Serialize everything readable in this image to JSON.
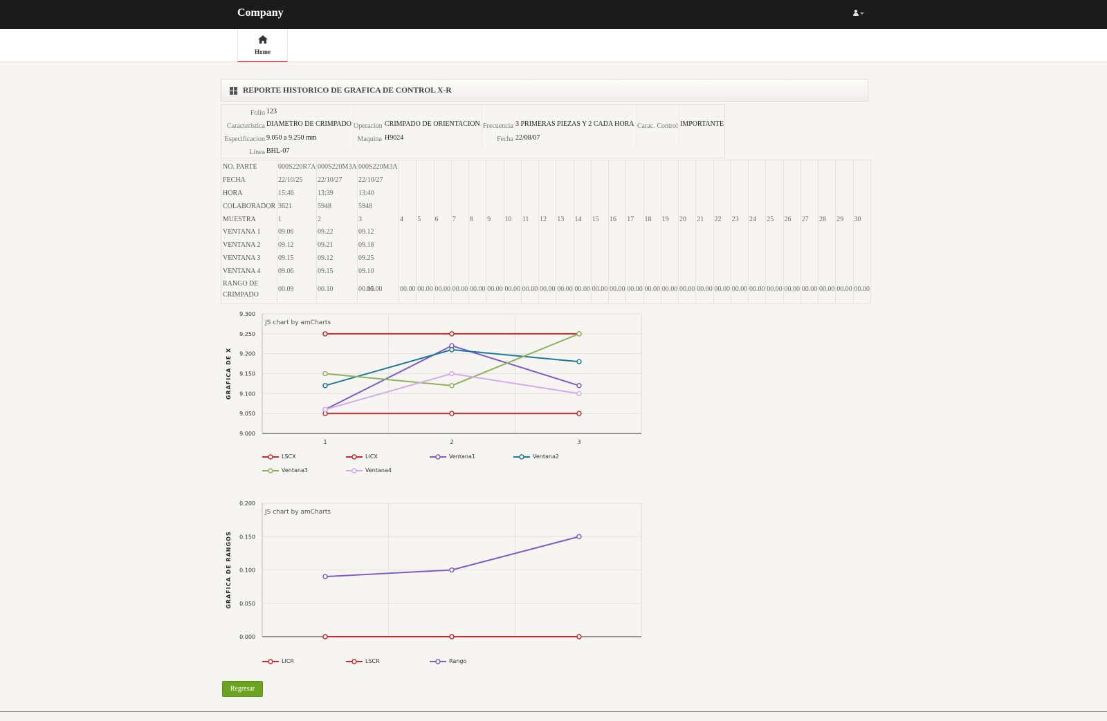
{
  "app": {
    "brand": "Company"
  },
  "nav": {
    "home_label": "Home"
  },
  "panel": {
    "title": "REPORTE HISTORICO DE GRAFICA DE CONTROL X-R"
  },
  "info": {
    "folio_label": "Folio",
    "folio": "123",
    "caracteristica_label": "Caracteristica",
    "caracteristica": "DIAMETRO DE CRIMPADO",
    "operacion_label": "Operacion",
    "operacion": "CRIMPADO DE ORIENTACION",
    "frecuencia_label": "Frecuencia",
    "frecuencia": "3 PRIMERAS PIEZAS Y 2 CADA HORA",
    "carac_control_label": "Carac. Control",
    "carac_control": "IMPORTANTE",
    "especificacion_label": "Especificacion",
    "especificacion": "9.050 a 9.250 mm",
    "maquina_label": "Maquina",
    "maquina": "H9024",
    "fecha_label": "Fecha",
    "fecha": "22/08/07",
    "linea_label": "Linea",
    "linea": "BHL-07"
  },
  "data_table": {
    "row_labels": [
      "NO. PARTE",
      "FECHA",
      "HORA",
      "COLABORADOR",
      "MUESTRA",
      "VENTANA 1",
      "VENTANA 2",
      "VENTANA 3",
      "VENTANA 4",
      "RANGO DE",
      "CRIMPADO"
    ],
    "columns": [
      {
        "parte": "000S220R7A",
        "fecha": "22/10/25",
        "hora": "15:46",
        "colaborador": "3621",
        "muestra": "1",
        "v1": "09.06",
        "v2": "09.12",
        "v3": "09.15",
        "v4": "09.06",
        "rango": "00.09"
      },
      {
        "parte": "000S220M3A",
        "fecha": "22/10/27",
        "hora": "13:39",
        "colaborador": "5948",
        "muestra": "2",
        "v1": "09.22",
        "v2": "09.21",
        "v3": "09.12",
        "v4": "09.15",
        "rango": "00.10"
      },
      {
        "parte": "000S220M3A",
        "fecha": "22/10/27",
        "hora": "13:40",
        "colaborador": "5948",
        "muestra": "3",
        "v1": "09.12",
        "v2": "09.18",
        "v3": "09.25",
        "v4": "09.10",
        "rango": "00.15"
      }
    ],
    "empty_samples": [
      "4",
      "5",
      "6",
      "7",
      "8",
      "9",
      "10",
      "11",
      "12",
      "13",
      "14",
      "15",
      "16",
      "17",
      "18",
      "19",
      "20",
      "21",
      "22",
      "23",
      "24",
      "25",
      "26",
      "27",
      "28",
      "29",
      "30"
    ],
    "empty_rango": "00.00"
  },
  "chart_data": [
    {
      "type": "line",
      "watermark": "JS chart by amCharts",
      "ylabel": "GRAFICA DE X",
      "xlabel": "",
      "categories": [
        "1",
        "2",
        "3"
      ],
      "ylim": [
        9.0,
        9.3
      ],
      "yticks": [
        "9.000",
        "9.050",
        "9.100",
        "9.150",
        "9.200",
        "9.250",
        "9.300"
      ],
      "grid": true,
      "legend_position": "bottom",
      "series": [
        {
          "name": "LSCX",
          "values": [
            9.25,
            9.25,
            9.25
          ],
          "color": "#cc2a2a"
        },
        {
          "name": "LICX",
          "values": [
            9.05,
            9.05,
            9.05
          ],
          "color": "#cc2a2a"
        },
        {
          "name": "Ventana1",
          "values": [
            9.06,
            9.22,
            9.12
          ],
          "color": "#7d5bc9"
        },
        {
          "name": "Ventana2",
          "values": [
            9.12,
            9.21,
            9.18
          ],
          "color": "#1b7a9c"
        },
        {
          "name": "Ventana3",
          "values": [
            9.15,
            9.12,
            9.25
          ],
          "color": "#8db35a"
        },
        {
          "name": "Ventana4",
          "values": [
            9.06,
            9.15,
            9.1
          ],
          "color": "#d5a9ec"
        }
      ]
    },
    {
      "type": "line",
      "watermark": "JS chart by amCharts",
      "ylabel": "GRAFICA DE RANGOS",
      "xlabel": "",
      "categories": [
        "1",
        "2",
        "3"
      ],
      "ylim": [
        0.0,
        0.2
      ],
      "yticks": [
        "0.000",
        "0.050",
        "0.100",
        "0.150",
        "0.200"
      ],
      "grid": true,
      "legend_position": "bottom",
      "series": [
        {
          "name": "LICR",
          "values": [
            0,
            0,
            0
          ],
          "color": "#cc2a2a"
        },
        {
          "name": "LSCR",
          "values": [
            0,
            0,
            0
          ],
          "color": "#cc2a2a"
        },
        {
          "name": "Rango",
          "values": [
            0.09,
            0.1,
            0.15
          ],
          "color": "#7d5bc9"
        }
      ]
    }
  ],
  "actions": {
    "back_label": "Regresar"
  },
  "colors": {
    "topbar": "#1b1b1b",
    "accent": "#e35b5a",
    "button": "#6aa420",
    "background": "#f7f5f1"
  }
}
